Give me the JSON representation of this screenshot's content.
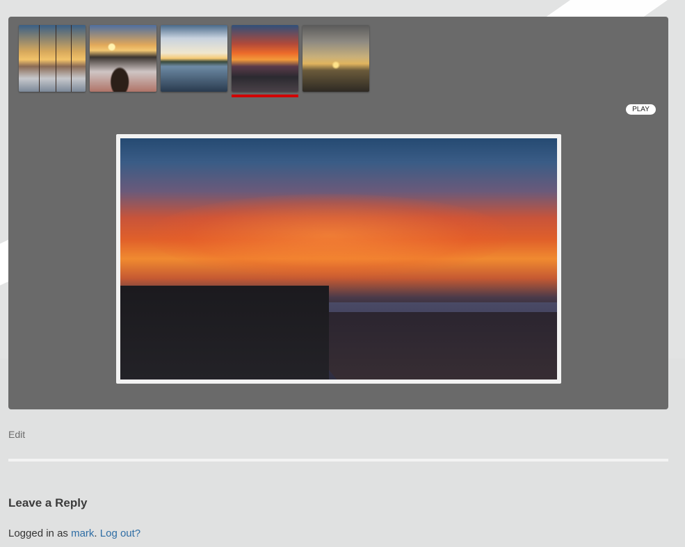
{
  "gallery": {
    "thumbnails": [
      {
        "subject": "pier-sunset"
      },
      {
        "subject": "dog-beach-sunset"
      },
      {
        "subject": "reflection-sunset"
      },
      {
        "subject": "seafront-sunset",
        "selected": true
      },
      {
        "subject": "silhouettes-sunset"
      }
    ],
    "selected_index": 3,
    "indicator_color": "#d10000",
    "play_label": "PLAY",
    "background_color": "#6a6a6a"
  },
  "post": {
    "edit_label": "Edit"
  },
  "comments": {
    "title": "Leave a Reply",
    "logged_in_prefix": "Logged in as ",
    "username": "mark",
    "separator": ". ",
    "logout_label": "Log out?",
    "link_color": "#2e6da4"
  }
}
